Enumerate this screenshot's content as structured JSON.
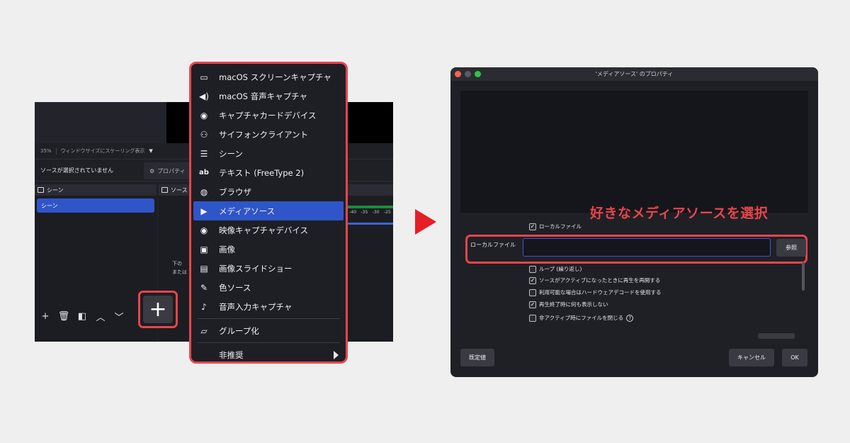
{
  "obs": {
    "zoom": "35%",
    "scale_mode": "ウィンドウサイズにスケーリング表示",
    "no_source_selected": "ソースが選択されていません",
    "properties_label": "プロパティ",
    "scenes_dock_title": "シーン",
    "sources_dock_title": "ソース",
    "scene_item": "シーン",
    "hint_line1": "下の",
    "hint_line2": "または",
    "mixer_ticks": [
      "-40",
      "-35",
      "-30",
      "-25"
    ],
    "bottom_icons": [
      "plus-icon",
      "trash-icon",
      "filter-icon",
      "up-icon",
      "down-icon"
    ]
  },
  "plus_button": "+",
  "menu": {
    "items": [
      {
        "icon": "monitor-icon",
        "glyph": "▭",
        "label": "macOS スクリーンキャプチャ"
      },
      {
        "icon": "speaker-icon",
        "glyph": "🔊",
        "label": "macOS 音声キャプチャ"
      },
      {
        "icon": "camera-icon",
        "glyph": "◉",
        "label": "キャプチャカードデバイス"
      },
      {
        "icon": "gamepad-icon",
        "glyph": "⌨",
        "label": "サイフォンクライアント"
      },
      {
        "icon": "list-icon",
        "glyph": "☰",
        "label": "シーン"
      },
      {
        "icon": "text-icon",
        "glyph": "ab",
        "label": "テキスト (FreeType 2)"
      },
      {
        "icon": "globe-icon",
        "glyph": "◍",
        "label": "ブラウザ"
      },
      {
        "icon": "play-icon",
        "glyph": "▶",
        "label": "メディアソース",
        "active": true
      },
      {
        "icon": "camera-icon",
        "glyph": "◉",
        "label": "映像キャプチャデバイス"
      },
      {
        "icon": "image-icon",
        "glyph": "▣",
        "label": "画像"
      },
      {
        "icon": "slideshow-icon",
        "glyph": "▤",
        "label": "画像スライドショー"
      },
      {
        "icon": "brush-icon",
        "glyph": "✎",
        "label": "色ソース"
      },
      {
        "icon": "microphone-icon",
        "glyph": "♪",
        "label": "音声入力キャプチャ"
      }
    ],
    "group_label": "グループ化",
    "deprecated_label": "非推奨"
  },
  "dialog": {
    "title": "'メディアソース' のプロパティ",
    "local_file_checkbox": "ローカルファイル",
    "local_file_label": "ローカルファイル",
    "local_file_value": "",
    "browse_button": "参照",
    "options": [
      {
        "label": "ループ (繰り返し)",
        "checked": false
      },
      {
        "label": "ソースがアクティブになったときに再生を再開する",
        "checked": true
      },
      {
        "label": "利用可能な場合はハードウェアデコードを使用する",
        "checked": false
      },
      {
        "label": "再生終了時に何も表示しない",
        "checked": true
      },
      {
        "label": "非アクティブ時にファイルを閉じる",
        "checked": false
      }
    ],
    "defaults_button": "既定値",
    "cancel_button": "キャンセル",
    "ok_button": "OK"
  },
  "caption": "好きなメディアソースを選択",
  "colors": {
    "accent_red": "#e8454b",
    "selection_blue": "#2f55c8",
    "arrow_red": "#e61e25"
  }
}
